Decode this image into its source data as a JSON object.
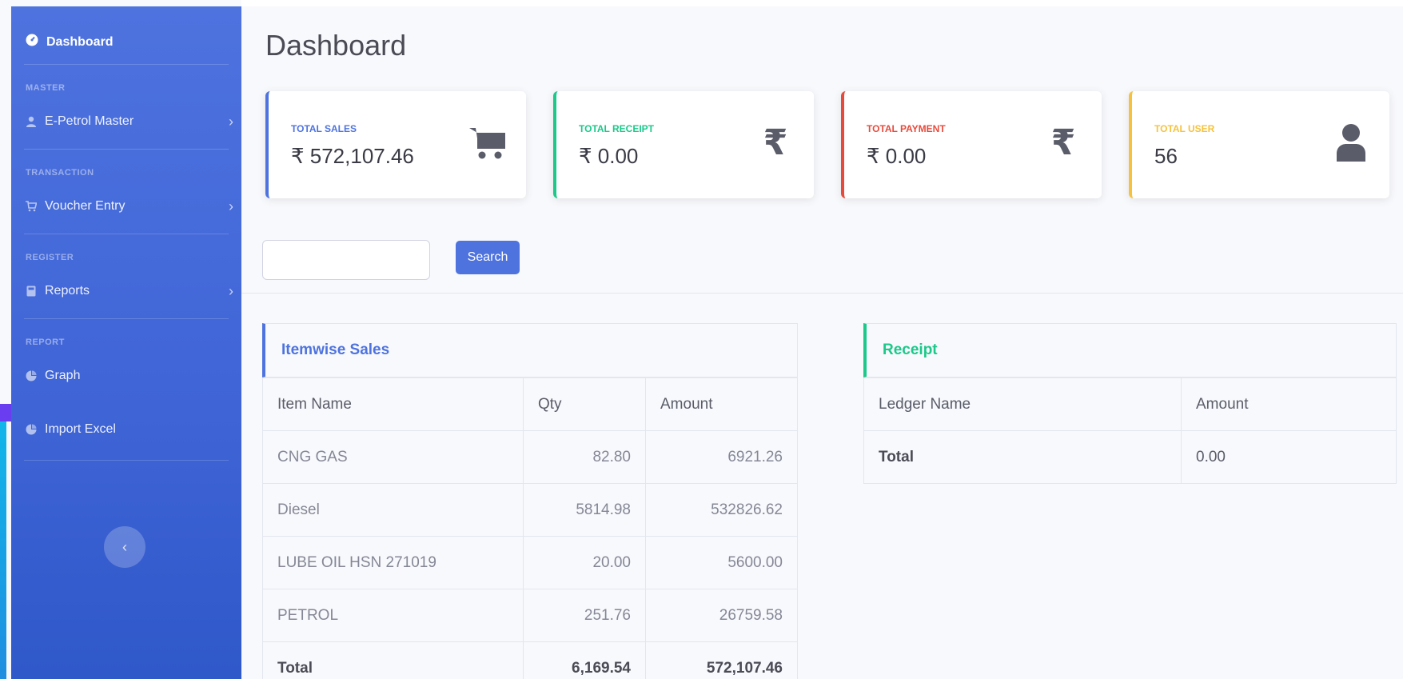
{
  "sidebar": {
    "brand": "Dashboard",
    "sections": [
      {
        "heading": "MASTER",
        "item": "E-Petrol Master",
        "icon": "user-icon"
      },
      {
        "heading": "TRANSACTION",
        "item": "Voucher Entry",
        "icon": "cart-icon"
      },
      {
        "heading": "REGISTER",
        "item": "Reports",
        "icon": "calculator-icon"
      },
      {
        "heading": "REPORT",
        "item": "Graph",
        "icon": "chart-icon"
      }
    ],
    "extra_item": "Import Excel",
    "toggle_symbol": "‹"
  },
  "page": {
    "title": "Dashboard"
  },
  "cards": [
    {
      "label": "TOTAL SALES",
      "value": "₹ 572,107.46",
      "icon": "cart-icon",
      "color": "#4e73df"
    },
    {
      "label": "TOTAL RECEIPT",
      "value": "₹ 0.00",
      "icon": "rupee-icon",
      "color": "#1cc88a"
    },
    {
      "label": "TOTAL PAYMENT",
      "value": "₹ 0.00",
      "icon": "rupee-icon",
      "color": "#e74a3b"
    },
    {
      "label": "TOTAL USER",
      "value": "56",
      "icon": "user-icon",
      "color": "#f6c23e"
    }
  ],
  "search": {
    "placeholder": "",
    "button": "Search"
  },
  "itemwise": {
    "title": "Itemwise Sales",
    "columns": [
      "Item Name",
      "Qty",
      "Amount"
    ],
    "rows": [
      [
        "CNG GAS",
        "82.80",
        "6921.26"
      ],
      [
        "Diesel",
        "5814.98",
        "532826.62"
      ],
      [
        "LUBE OIL HSN 271019",
        "20.00",
        "5600.00"
      ],
      [
        "PETROL",
        "251.76",
        "26759.58"
      ]
    ],
    "total": [
      "Total",
      "6,169.54",
      "572,107.46"
    ]
  },
  "receipt": {
    "title": "Receipt",
    "columns": [
      "Ledger Name",
      "Amount"
    ],
    "total": [
      "Total",
      "0.00"
    ]
  }
}
